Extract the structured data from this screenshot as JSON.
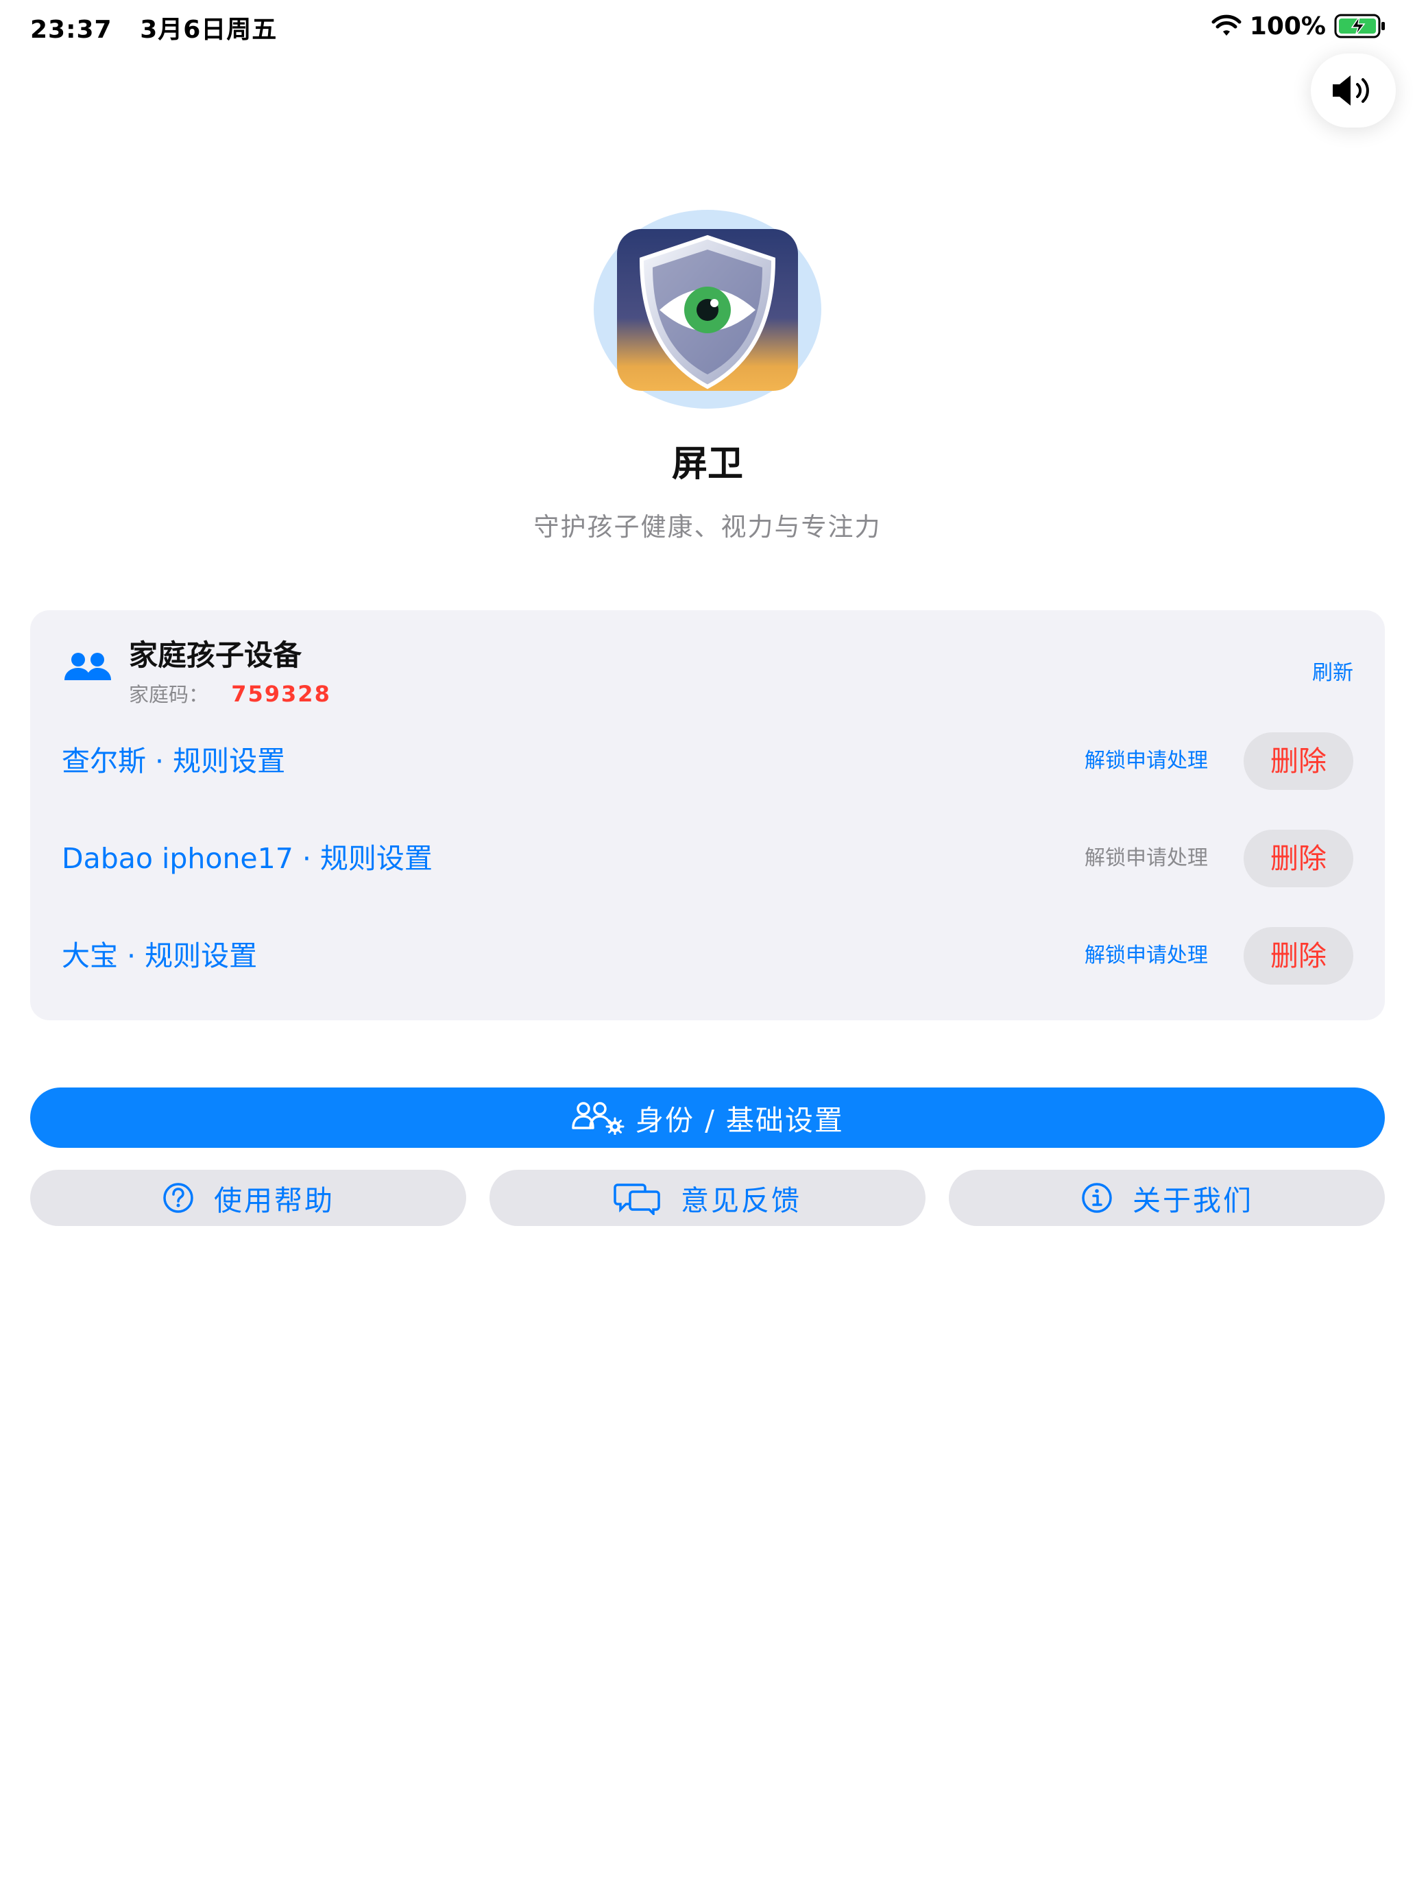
{
  "status_bar": {
    "time": "23:37",
    "date": "3月6日周五",
    "battery": "100%"
  },
  "app": {
    "title": "屏卫",
    "subtitle": "守护孩子健康、视力与专注力"
  },
  "devices_card": {
    "title": "家庭孩子设备",
    "family_code_label": "家庭码：",
    "family_code": "759328",
    "refresh_label": "刷新",
    "devices": [
      {
        "name": "查尔斯 · 规则设置",
        "unlock_label": "解锁申请处理",
        "delete_label": "删除"
      },
      {
        "name": "Dabao iphone17 · 规则设置",
        "unlock_label": "解锁申请处理",
        "delete_label": "删除"
      },
      {
        "name": "大宝 · 规则设置",
        "unlock_label": "解锁申请处理",
        "delete_label": "删除"
      }
    ]
  },
  "buttons": {
    "identity_settings": "身份 / 基础设置",
    "help": "使用帮助",
    "feedback": "意见反馈",
    "about": "关于我们"
  },
  "colors": {
    "accent": "#007aff",
    "primary_button": "#0a84ff",
    "danger": "#ff3b30",
    "card_background": "#f2f2f7"
  },
  "icons": {
    "wifi": "wifi-icon",
    "battery": "battery-charging-icon",
    "sound": "speaker-icon",
    "family": "people-icon",
    "identity": "people-gear-icon",
    "help": "question-circle-icon",
    "feedback": "chat-bubbles-icon",
    "about": "info-circle-icon"
  }
}
